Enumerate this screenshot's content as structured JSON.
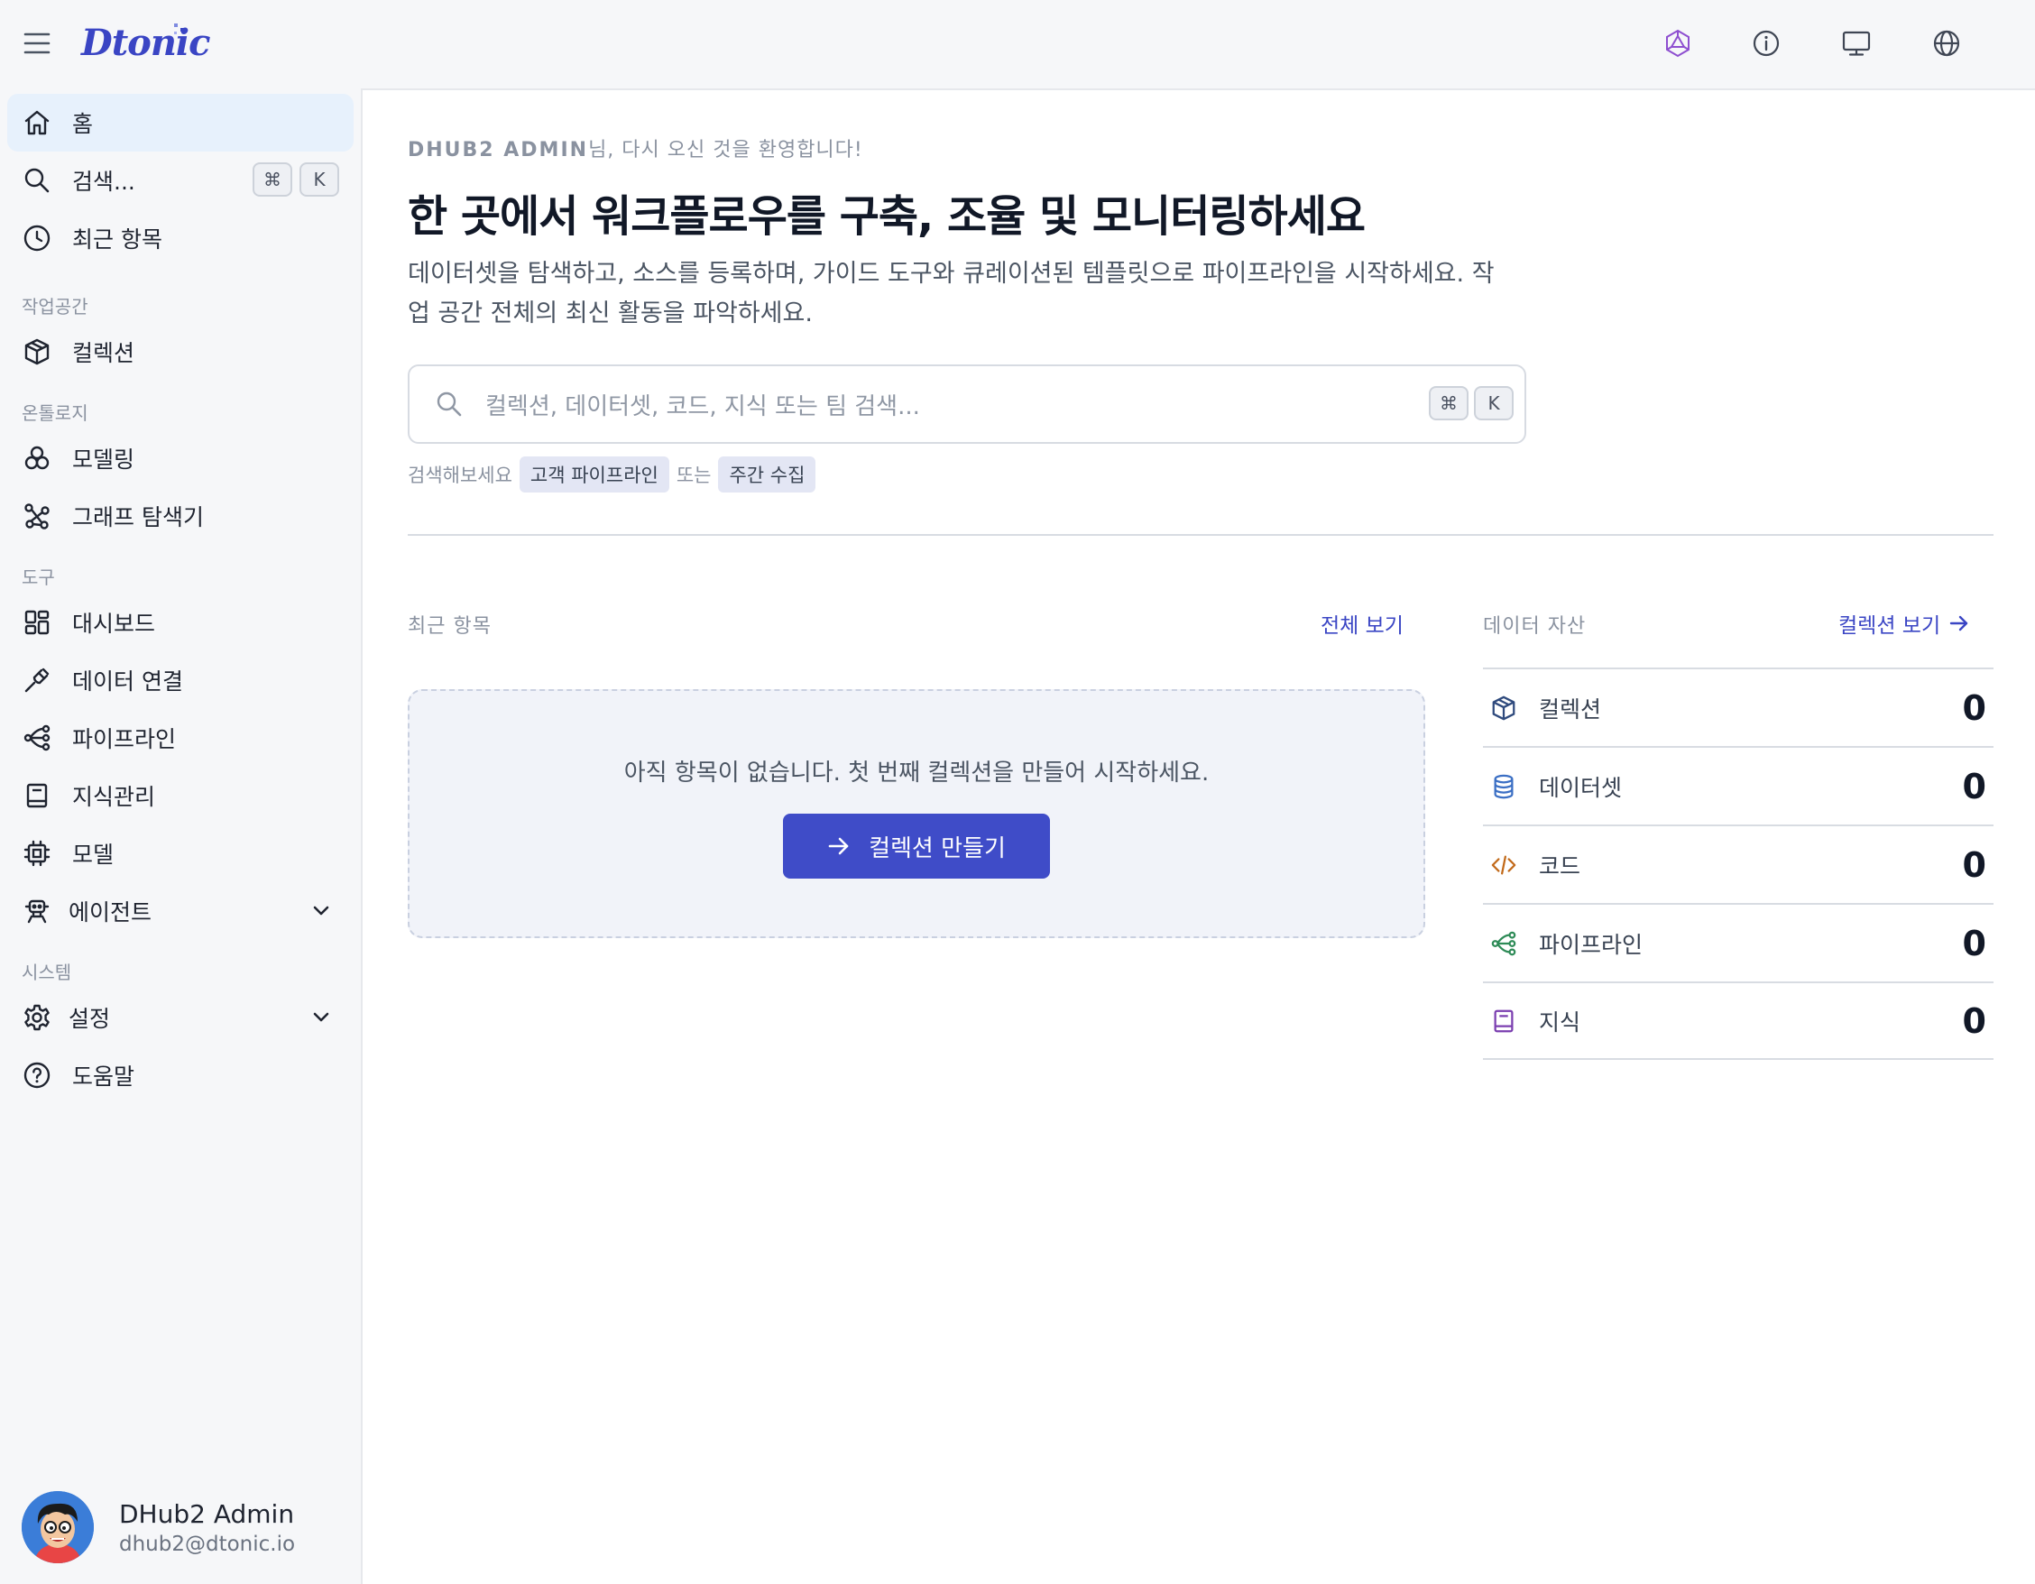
{
  "app": {
    "logo_text": "Dtonic"
  },
  "topbar": {
    "icons": [
      "ai-model-icon",
      "info-icon",
      "monitor-icon",
      "globe-icon"
    ]
  },
  "sidebar": {
    "home": "홈",
    "search": "검색...",
    "search_kbd_cmd": "⌘",
    "search_kbd_key": "K",
    "recent": "최근 항목",
    "sections": {
      "workspace": "작업공간",
      "ontology": "온톨로지",
      "tools": "도구",
      "system": "시스템"
    },
    "collections": "컬렉션",
    "modeling": "모델링",
    "graph_explorer": "그래프 탐색기",
    "dashboard": "대시보드",
    "data_connection": "데이터 연결",
    "pipeline": "파이프라인",
    "knowledge": "지식관리",
    "model": "모델",
    "agent": "에이전트",
    "settings": "설정",
    "help": "도움말"
  },
  "user": {
    "name": "DHub2 Admin",
    "email": "dhub2@dtonic.io"
  },
  "main": {
    "welcome_name": "DHUB2 ADMIN",
    "welcome_rest": "님, 다시 오신 것을 환영합니다!",
    "headline": "한 곳에서 워크플로우를 구축, 조율 및 모니터링하세요",
    "subtext": "데이터셋을 탐색하고, 소스를 등록하며, 가이드 도구와 큐레이션된 템플릿으로 파이프라인을 시작하세요. 작업 공간 전체의 최신 활동을 파악하세요.",
    "search_placeholder": "컬렉션, 데이터셋, 코드, 지식 또는 팀 검색...",
    "search_kbd_cmd": "⌘",
    "search_kbd_key": "K",
    "try_prefix": "검색해보세요",
    "try_chip_1": "고객 파이프라인",
    "try_or": "또는",
    "try_chip_2": "주간 수집",
    "recent_title": "최근 항목",
    "view_all": "전체 보기",
    "empty_text": "아직 항목이 없습니다. 첫 번째 컬렉션을 만들어 시작하세요.",
    "create_button": "컬렉션 만들기",
    "assets_title": "데이터 자산",
    "assets_link": "컬렉션 보기",
    "assets": [
      {
        "name": "컬렉션",
        "count": "0",
        "icon": "cube-icon",
        "color": "#2f4a7d"
      },
      {
        "name": "데이터셋",
        "count": "0",
        "icon": "database-icon",
        "color": "#3b6fc4"
      },
      {
        "name": "코드",
        "count": "0",
        "icon": "code-icon",
        "color": "#c26a1a"
      },
      {
        "name": "파이프라인",
        "count": "0",
        "icon": "share-nodes-icon",
        "color": "#2e8b57"
      },
      {
        "name": "지식",
        "count": "0",
        "icon": "book-icon",
        "color": "#7b3fb0"
      }
    ]
  },
  "colors": {
    "accent": "#3f4cc8",
    "link": "#3a45c4",
    "active_nav_bg": "#e7f1fc"
  }
}
